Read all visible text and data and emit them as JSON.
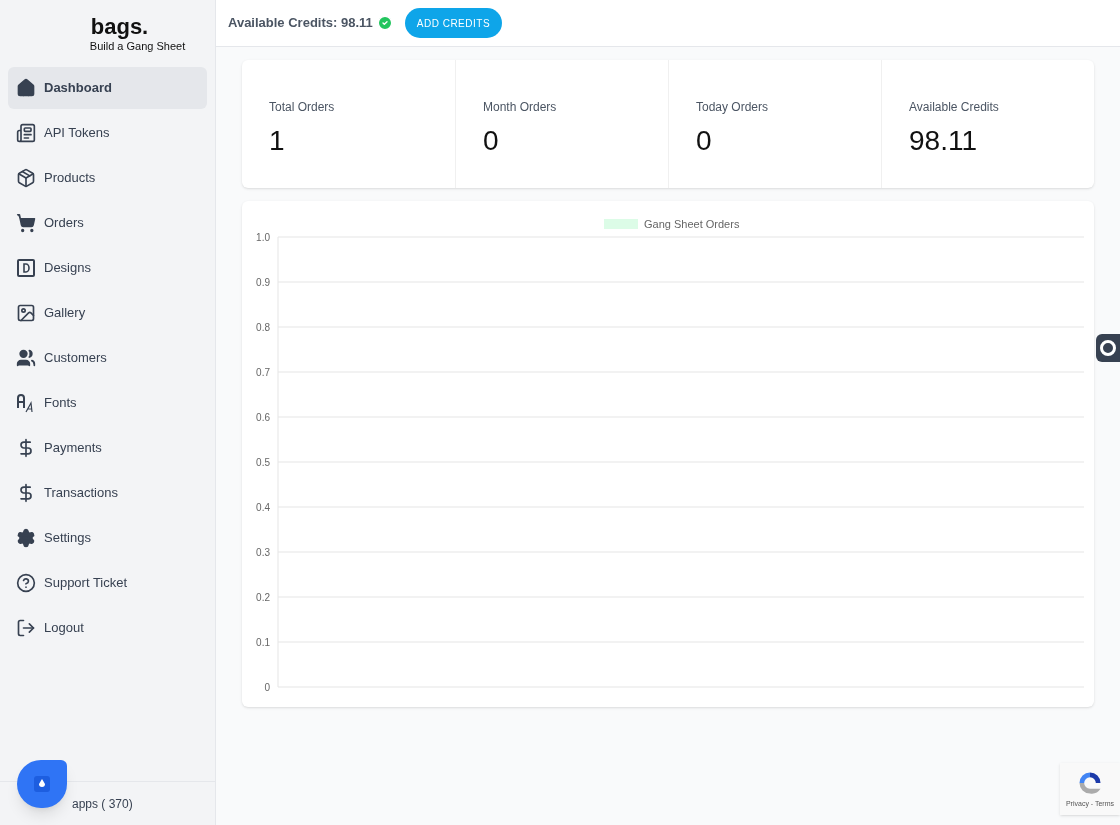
{
  "brand": {
    "name": "bags.",
    "tagline": "Build a Gang Sheet"
  },
  "sidebar": {
    "items": [
      {
        "label": "Dashboard",
        "selected": true
      },
      {
        "label": "API Tokens",
        "selected": false
      },
      {
        "label": "Products",
        "selected": false
      },
      {
        "label": "Orders",
        "selected": false
      },
      {
        "label": "Designs",
        "selected": false
      },
      {
        "label": "Gallery",
        "selected": false
      },
      {
        "label": "Customers",
        "selected": false
      },
      {
        "label": "Fonts",
        "selected": false
      },
      {
        "label": "Payments",
        "selected": false
      },
      {
        "label": "Transactions",
        "selected": false
      },
      {
        "label": "Settings",
        "selected": false
      },
      {
        "label": "Support Ticket",
        "selected": false
      },
      {
        "label": "Logout",
        "selected": false
      }
    ],
    "footer": "apps ( 370)"
  },
  "header": {
    "credits": "Available Credits: 98.11",
    "button": "ADD CREDITS"
  },
  "stats": [
    {
      "label": "Total Orders",
      "value": "1"
    },
    {
      "label": "Month Orders",
      "value": "0"
    },
    {
      "label": "Today Orders",
      "value": "0"
    },
    {
      "label": "Available Credits",
      "value": "98.11"
    }
  ],
  "chart": {
    "chart_data": {
      "type": "line",
      "grid": true,
      "ylim": [
        0,
        1
      ],
      "yticks": [
        0,
        0.1,
        0.2,
        0.3,
        0.4,
        0.5,
        0.6,
        0.7,
        0.8,
        0.9,
        {
          "value": 1,
          "label": "1.0"
        }
      ],
      "series": [
        {
          "name": "Gang Sheet Orders",
          "color": "#dcfce7"
        }
      ]
    }
  },
  "recaptcha": {
    "text": "Privacy - Terms"
  }
}
